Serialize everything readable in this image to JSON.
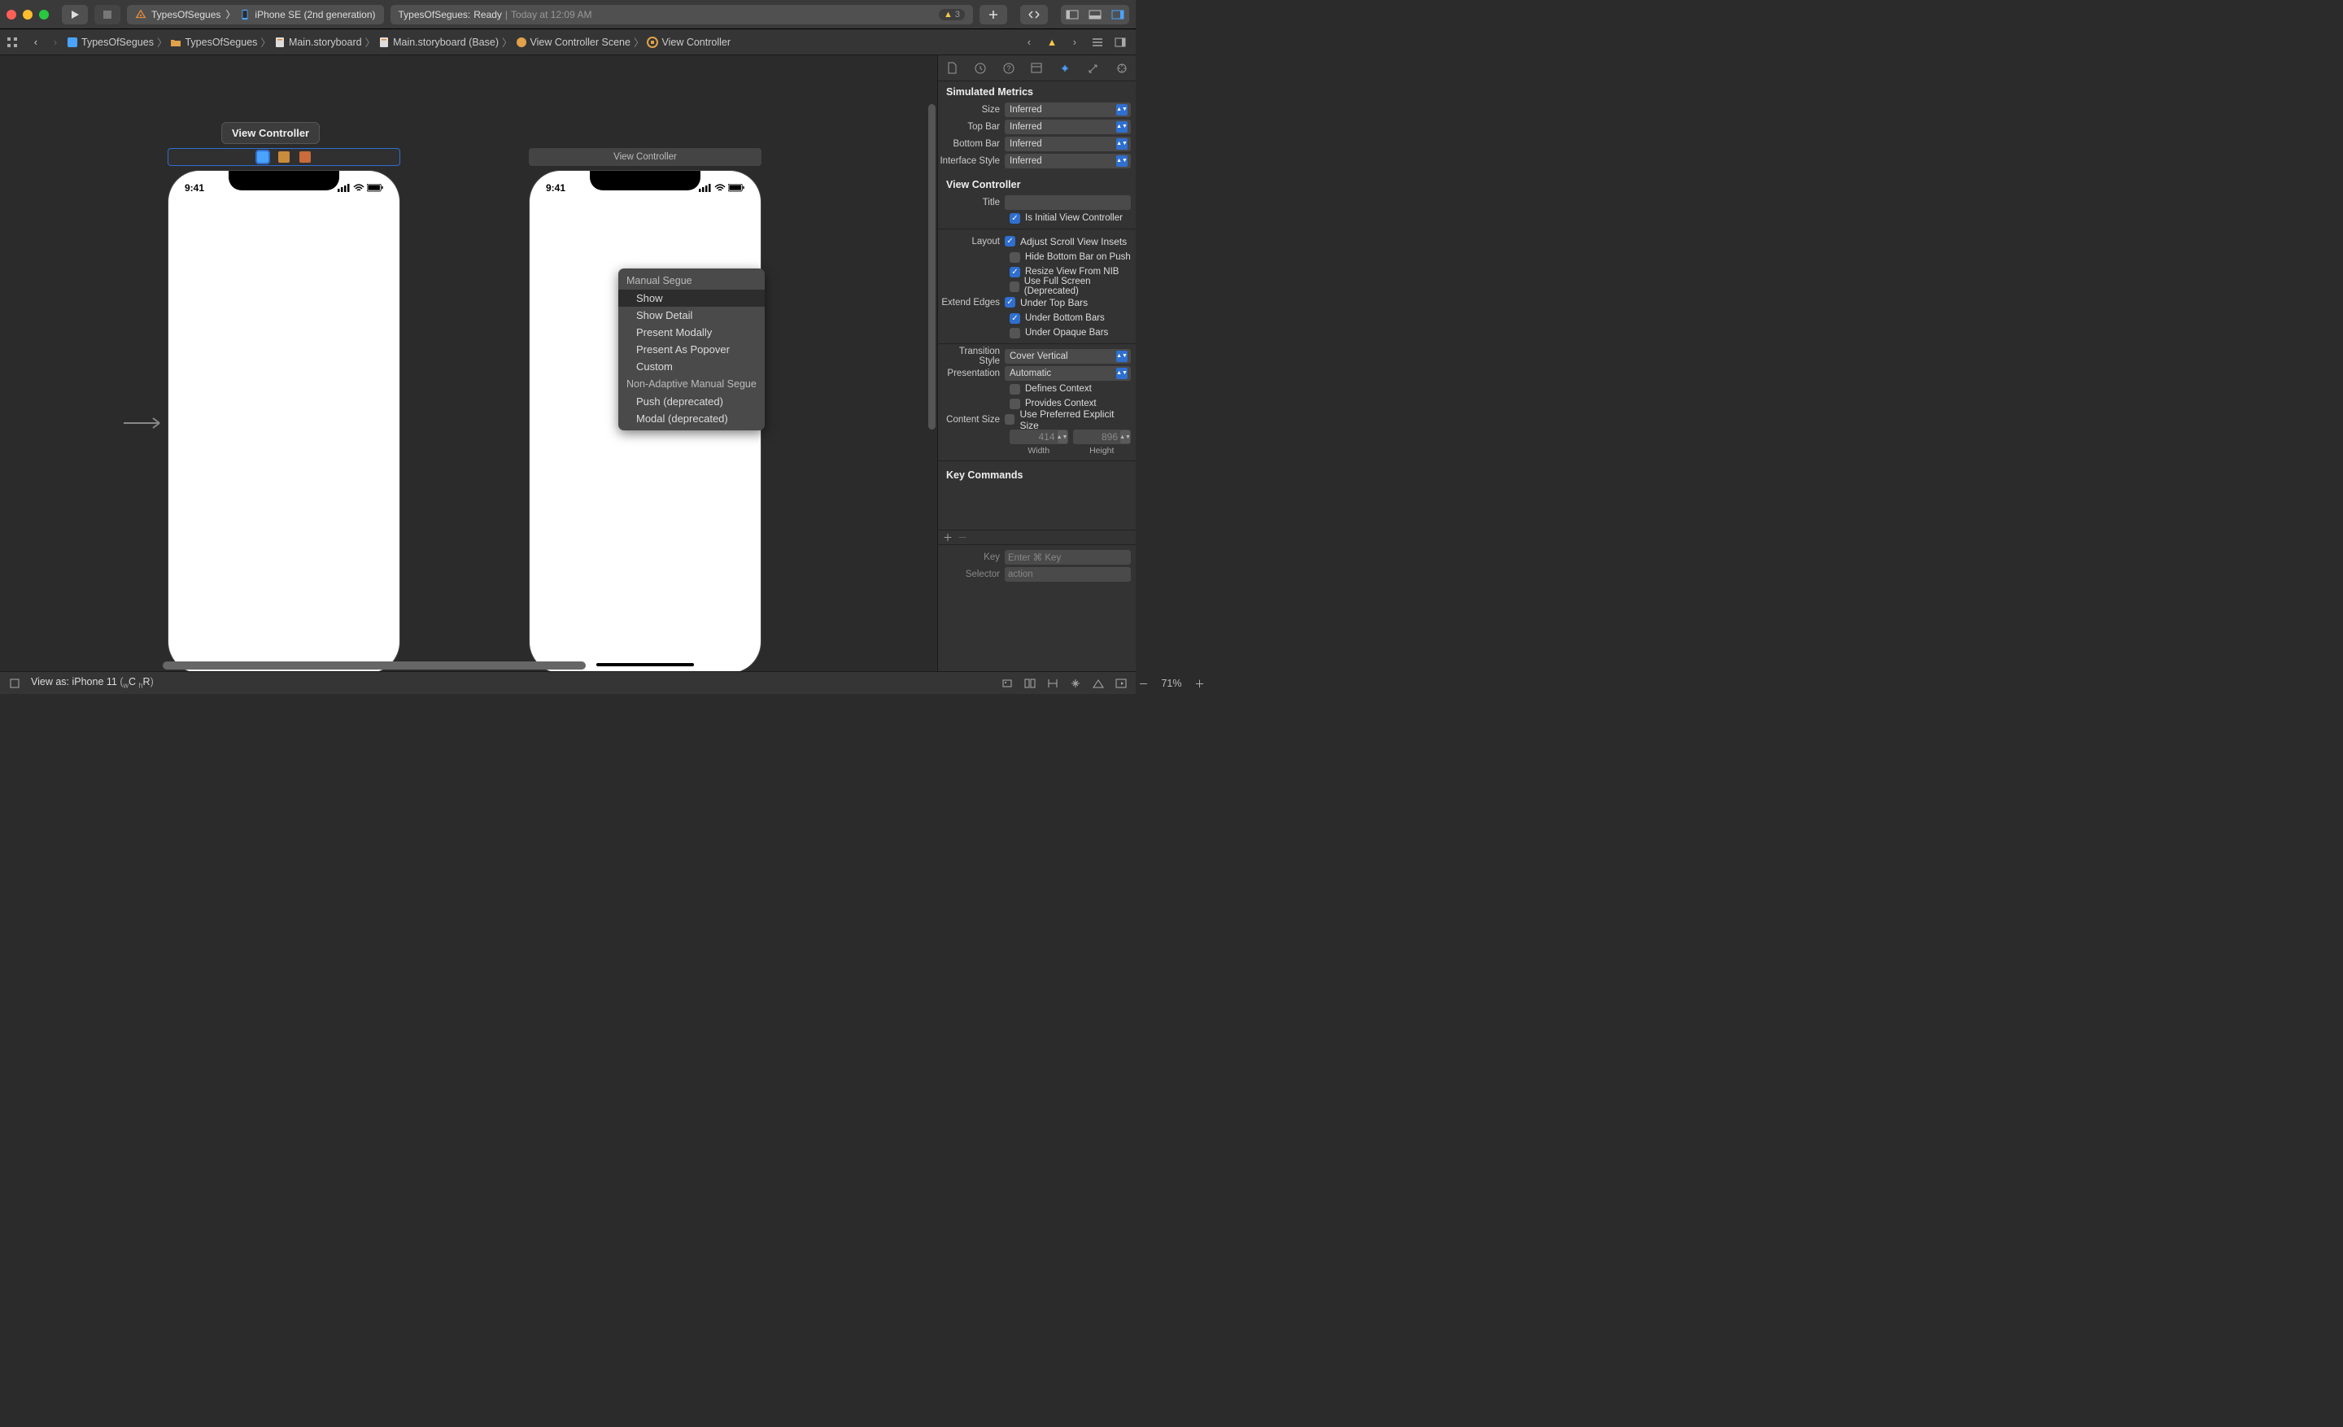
{
  "toolbar": {
    "scheme": "TypesOfSegues",
    "device": "iPhone SE (2nd generation)",
    "status_app": "TypesOfSegues:",
    "status_state": "Ready",
    "status_sep": " | ",
    "status_time": "Today at 12:09 AM",
    "warning_count": "3"
  },
  "breadcrumbs": {
    "items": [
      {
        "label": "TypesOfSegues",
        "icon": "project"
      },
      {
        "label": "TypesOfSegues",
        "icon": "folder"
      },
      {
        "label": "Main.storyboard",
        "icon": "storyboard"
      },
      {
        "label": "Main.storyboard (Base)",
        "icon": "storyboard"
      },
      {
        "label": "View Controller Scene",
        "icon": "scene"
      },
      {
        "label": "View Controller",
        "icon": "viewcontroller"
      }
    ]
  },
  "scene1": {
    "title": "View Controller",
    "time": "9:41"
  },
  "scene2": {
    "title": "View Controller",
    "time": "9:41"
  },
  "segue_menu": {
    "header1": "Manual Segue",
    "items1": [
      "Show",
      "Show Detail",
      "Present Modally",
      "Present As Popover",
      "Custom"
    ],
    "header2": "Non-Adaptive Manual Segue",
    "items2": [
      "Push (deprecated)",
      "Modal (deprecated)"
    ],
    "selected": "Show"
  },
  "inspector": {
    "section_simulated": "Simulated Metrics",
    "size_label": "Size",
    "size_value": "Inferred",
    "topbar_label": "Top Bar",
    "topbar_value": "Inferred",
    "bottombar_label": "Bottom Bar",
    "bottombar_value": "Inferred",
    "ifstyle_label": "Interface Style",
    "ifstyle_value": "Inferred",
    "section_vc": "View Controller",
    "title_label": "Title",
    "title_value": "",
    "is_initial": "Is Initial View Controller",
    "layout_label": "Layout",
    "adjust_insets": "Adjust Scroll View Insets",
    "hide_bottom_push": "Hide Bottom Bar on Push",
    "resize_nib": "Resize View From NIB",
    "use_full_screen": "Use Full Screen (Deprecated)",
    "extend_label": "Extend Edges",
    "under_top": "Under Top Bars",
    "under_bottom": "Under Bottom Bars",
    "under_opaque": "Under Opaque Bars",
    "transition_label": "Transition Style",
    "transition_value": "Cover Vertical",
    "presentation_label": "Presentation",
    "presentation_value": "Automatic",
    "defines_context": "Defines Context",
    "provides_context": "Provides Context",
    "content_size_label": "Content Size",
    "use_preferred": "Use Preferred Explicit Size",
    "width_value": "414",
    "width_label": "Width",
    "height_value": "896",
    "height_label": "Height",
    "section_kc": "Key Commands",
    "kc_key_label": "Key",
    "kc_key_placeholder": "Enter ⌘ Key",
    "kc_sel_label": "Selector",
    "kc_sel_placeholder": "action"
  },
  "bottombar": {
    "view_as": "View as: iPhone 11",
    "traits": "(wC hR)",
    "zoom": "71%"
  }
}
